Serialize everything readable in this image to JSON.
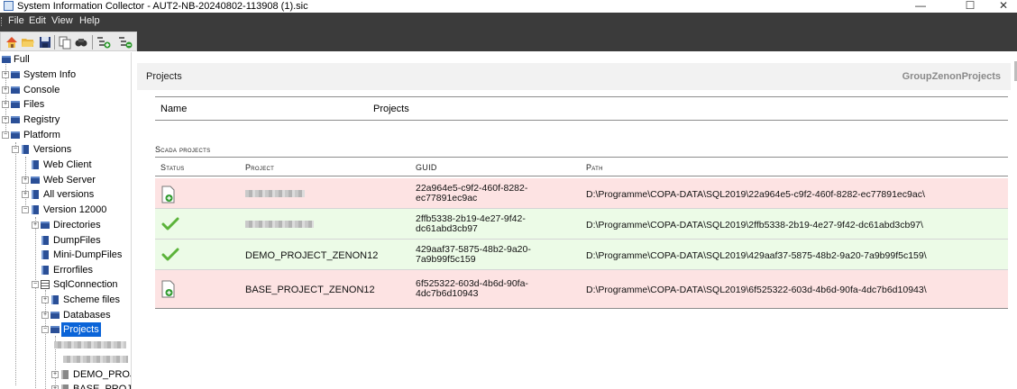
{
  "window": {
    "title": "System Information Collector - AUT2-NB-20240802-113908 (1).sic",
    "controls": [
      "—",
      "☐",
      "✕"
    ]
  },
  "menu": [
    "File",
    "Edit",
    "View",
    "Help"
  ],
  "toolbar": {
    "icons": [
      "home-icon",
      "open-folder-icon",
      "save-icon",
      "copy-icon",
      "find-icon",
      "add-item-icon",
      "add-item-alt-icon"
    ]
  },
  "tree": {
    "items": [
      {
        "label": "Full"
      },
      {
        "label": "System Info"
      },
      {
        "label": "Console"
      },
      {
        "label": "Files"
      },
      {
        "label": "Registry"
      },
      {
        "label": "Platform"
      },
      {
        "label": "Versions"
      },
      {
        "label": "Web Client"
      },
      {
        "label": "Web Server"
      },
      {
        "label": "All versions"
      },
      {
        "label": "Version 12000"
      },
      {
        "label": "Directories"
      },
      {
        "label": "DumpFiles"
      },
      {
        "label": "Mini-DumpFiles"
      },
      {
        "label": "Errorfiles"
      },
      {
        "label": "SqlConnection"
      },
      {
        "label": "Scheme files"
      },
      {
        "label": "Databases"
      },
      {
        "label": "Projects"
      },
      {
        "label": "DEMO_PROJ"
      },
      {
        "label": "BASE_PROJE"
      }
    ]
  },
  "detail": {
    "header_title": "Projects",
    "header_right": "GroupZenonProjects",
    "name_key": "Name",
    "name_value": "Projects",
    "section_caption": "Scada projects",
    "columns": [
      "Status",
      "Project",
      "GUID",
      "Path"
    ],
    "rows": [
      {
        "status": "document-add-icon",
        "project": "",
        "guid": "22a964e5-c9f2-460f-8282-ec77891ec9ac",
        "path": "D:\\Programme\\COPA-DATA\\SQL2019\\22a964e5-c9f2-460f-8282-ec77891ec9ac\\",
        "color": "#fde3e3"
      },
      {
        "status": "checkmark-icon",
        "project": "",
        "guid": "2ffb5338-2b19-4e27-9f42-dc61abd3cb97",
        "path": "D:\\Programme\\COPA-DATA\\SQL2019\\2ffb5338-2b19-4e27-9f42-dc61abd3cb97\\",
        "color": "#ecfbe7"
      },
      {
        "status": "checkmark-icon",
        "project": "DEMO_PROJECT_ZENON12",
        "guid": "429aaf37-5875-48b2-9a20-7a9b99f5c159",
        "path": "D:\\Programme\\COPA-DATA\\SQL2019\\429aaf37-5875-48b2-9a20-7a9b99f5c159\\",
        "color": "#ecfbe7"
      },
      {
        "status": "document-add-icon",
        "project": "BASE_PROJECT_ZENON12",
        "guid": "6f525322-603d-4b6d-90fa-4dc7b6d10943",
        "path": "D:\\Programme\\COPA-DATA\\SQL2019\\6f525322-603d-4b6d-90fa-4dc7b6d10943\\",
        "color": "#fde3e3"
      }
    ]
  }
}
